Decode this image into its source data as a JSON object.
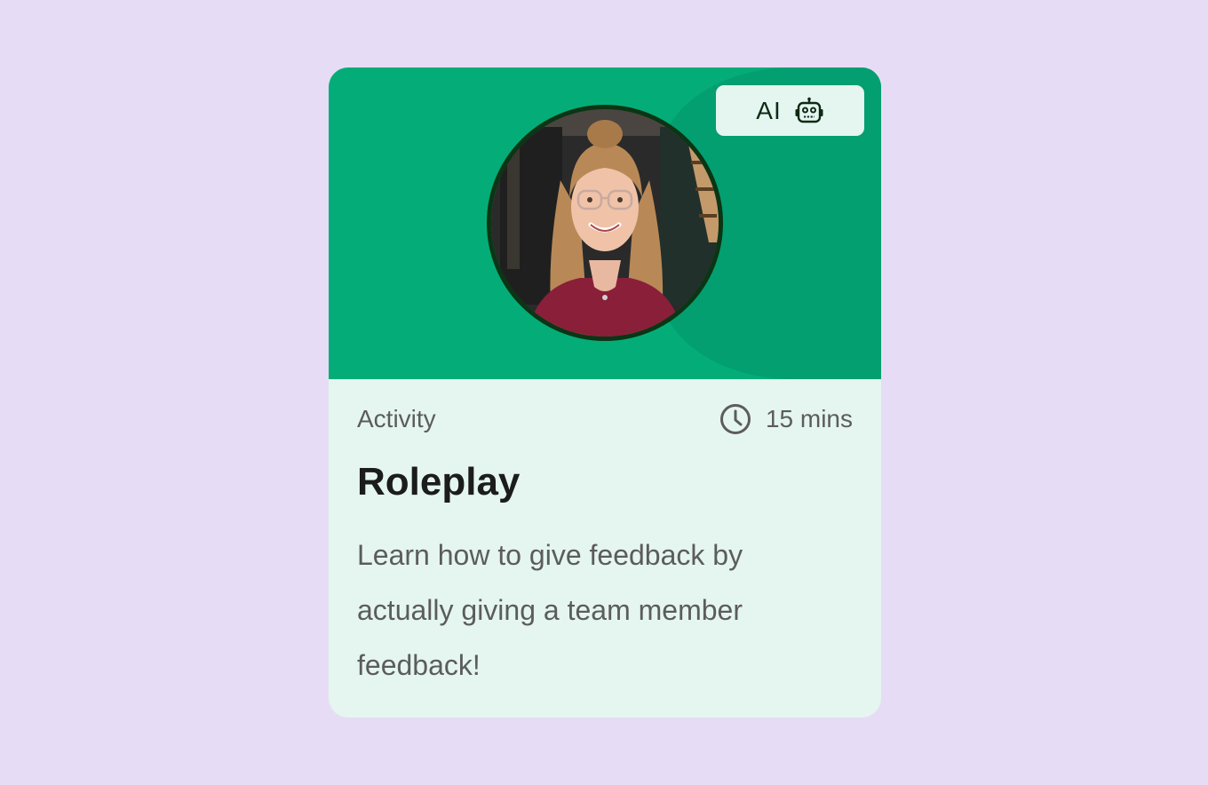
{
  "card": {
    "badge_label": "AI",
    "badge_icon": "robot-icon",
    "activity_type": "Activity",
    "duration_icon": "clock-icon",
    "duration": "15 mins",
    "title": "Roleplay",
    "description": "Learn how to give feedback by actually giving a team member feedback!"
  },
  "colors": {
    "page_background": "#e7dcf5",
    "hero_green": "#04ad78",
    "card_body": "#e4f6ef",
    "avatar_ring": "#0b3514",
    "title_text": "#1c1c1c",
    "muted_text": "#5c5c5c"
  }
}
